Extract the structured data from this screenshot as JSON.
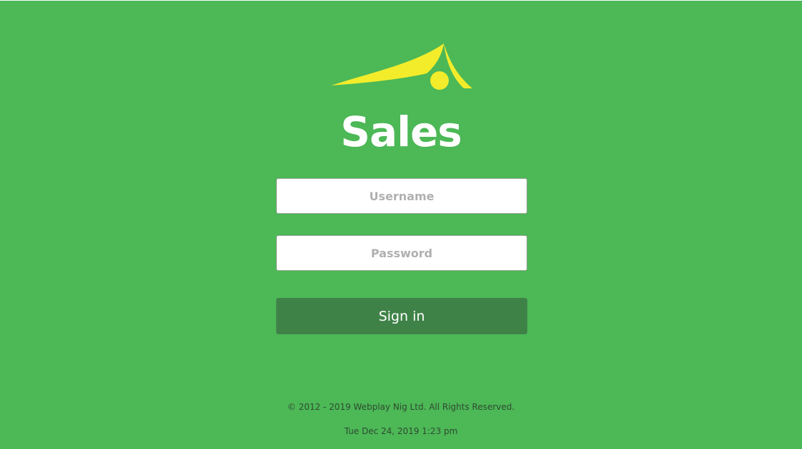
{
  "app": {
    "title": "Sales",
    "logo_icon": "tent-with-sun-logo-icon",
    "colors": {
      "background": "#4cb856",
      "logo_yellow": "#f3ec2b",
      "button": "#3f8248"
    }
  },
  "login": {
    "username_placeholder": "Username",
    "password_placeholder": "Password",
    "signin_label": "Sign in"
  },
  "footer": {
    "copyright": "© 2012 - 2019 Webplay Nig Ltd. All Rights Reserved.",
    "datetime": "Tue Dec 24, 2019 1:23 pm"
  }
}
